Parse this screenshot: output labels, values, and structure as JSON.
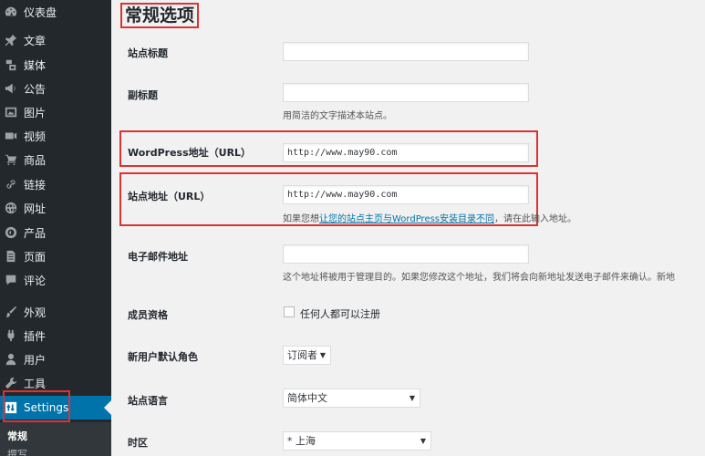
{
  "sidebar": {
    "items": [
      {
        "label": "仪表盘",
        "icon": "dashboard-icon"
      },
      {
        "label": "文章",
        "icon": "pin-icon"
      },
      {
        "label": "媒体",
        "icon": "media-icon"
      },
      {
        "label": "公告",
        "icon": "megaphone-icon"
      },
      {
        "label": "图片",
        "icon": "image-icon"
      },
      {
        "label": "视频",
        "icon": "video-icon"
      },
      {
        "label": "商品",
        "icon": "cart-icon"
      },
      {
        "label": "链接",
        "icon": "link-icon"
      },
      {
        "label": "网址",
        "icon": "globe-icon"
      },
      {
        "label": "产品",
        "icon": "product-icon"
      },
      {
        "label": "页面",
        "icon": "page-icon"
      },
      {
        "label": "评论",
        "icon": "comment-icon"
      },
      {
        "label": "外观",
        "icon": "brush-icon"
      },
      {
        "label": "插件",
        "icon": "plugin-icon"
      },
      {
        "label": "用户",
        "icon": "user-icon"
      },
      {
        "label": "工具",
        "icon": "wrench-icon"
      },
      {
        "label": "Settings",
        "icon": "settings-icon"
      }
    ],
    "submenu": {
      "current": "常规",
      "next": "撰写"
    }
  },
  "page": {
    "title": "常规选项"
  },
  "fields": {
    "site_title": {
      "label": "站点标题",
      "value": ""
    },
    "tagline": {
      "label": "副标题",
      "value": "",
      "description": "用简洁的文字描述本站点。"
    },
    "wp_url": {
      "label": "WordPress地址（URL）",
      "value": "http://www.may90.com"
    },
    "site_url": {
      "label": "站点地址（URL）",
      "value": "http://www.may90.com",
      "description_prefix": "如果您想",
      "description_link": "让您的站点主页与WordPress安装目录不同",
      "description_suffix": "，请在此输入地址。"
    },
    "email": {
      "label": "电子邮件地址",
      "value": "",
      "description": "这个地址将被用于管理目的。如果您修改这个地址，我们将会向新地址发送电子邮件来确认。新地"
    },
    "membership": {
      "label": "成员资格",
      "checkbox_label": "任何人都可以注册"
    },
    "default_role": {
      "label": "新用户默认角色",
      "value": "订阅者"
    },
    "language": {
      "label": "站点语言",
      "value": "简体中文"
    },
    "timezone": {
      "label": "时区",
      "value": "* 上海"
    }
  },
  "colors": {
    "sidebar_bg": "#23282d",
    "active_bg": "#0073aa",
    "highlight": "#dc3232",
    "link": "#0073aa"
  }
}
